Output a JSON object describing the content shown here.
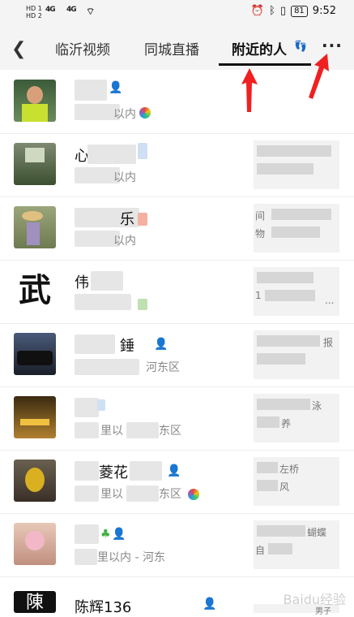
{
  "status": {
    "time": "9:52",
    "battery": "81",
    "sim1": "HD 1",
    "sim2": "HD 2",
    "net": "4G"
  },
  "header": {
    "tabs": [
      {
        "label": "临沂视频"
      },
      {
        "label": "同城直播"
      },
      {
        "label": "附近的人",
        "active": true
      }
    ],
    "more_label": "···"
  },
  "rows": [
    {
      "name": "",
      "dist": "以内",
      "card": []
    },
    {
      "name": "心",
      "dist": "以内",
      "card": []
    },
    {
      "name": "乐",
      "dist": "以内",
      "card": [
        "间",
        "物"
      ]
    },
    {
      "name": "伟",
      "dist": "",
      "card": [
        "",
        "1"
      ],
      "card_more": "..."
    },
    {
      "name": "錘",
      "dist": "河东区",
      "card": [
        "",
        "报"
      ]
    },
    {
      "name": "",
      "dist": "里以",
      "dist2": "东区",
      "card": [
        "",
        "泳",
        "养"
      ]
    },
    {
      "name": "菱花",
      "dist": "里以",
      "dist2": "东区",
      "card": [
        "左桥",
        "风"
      ]
    },
    {
      "name": "",
      "dist": "里以内 - 河东",
      "card": [
        "",
        "蝴蝶",
        "自"
      ]
    },
    {
      "name": "陈辉136",
      "dist": "",
      "card": [
        "男子"
      ]
    }
  ],
  "watermark": "Baidu经验"
}
